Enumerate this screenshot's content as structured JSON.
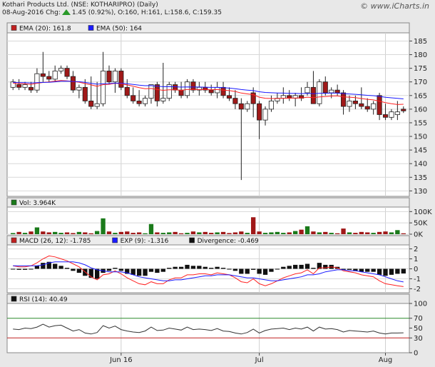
{
  "header": {
    "line1": "Kothari Products Ltd. (NSE: KOTHARIPRO) (Daily)",
    "date_chg": "08-Aug-2016 Chg:",
    "change": "1.45 (0.92%), O:160, H:161, L:158.6, C:159.35"
  },
  "brand": "© www.iCharts.in",
  "colors": {
    "up": "#ffffff",
    "down": "#a01818",
    "ema20": "#ff2020",
    "ema50": "#1a1aff",
    "vol_up": "#1a7a1a",
    "vol_down": "#a01818",
    "macd": "#ff2020",
    "signal": "#1a1aff",
    "rsi": "#333333",
    "rsi_upper": "#2a8a2a",
    "rsi_lower": "#c02020"
  },
  "chart_data": [
    {
      "type": "candlestick",
      "legend": [
        {
          "label": "EMA (20): 161.8",
          "color": "#c02020"
        },
        {
          "label": "EMA (50): 164",
          "color": "#1a1aff"
        }
      ],
      "ylim": [
        128,
        188
      ],
      "yticks": [
        130,
        135,
        140,
        145,
        150,
        155,
        160,
        165,
        170,
        175,
        180,
        185
      ],
      "xticks": [
        {
          "label": "Jun 16",
          "index": 18
        },
        {
          "label": "Jul",
          "index": 41
        },
        {
          "label": "Aug",
          "index": 62
        }
      ],
      "ohlc": [
        [
          168,
          171,
          167,
          170
        ],
        [
          169,
          171,
          167,
          168
        ],
        [
          168,
          170,
          167,
          169
        ],
        [
          168,
          170,
          166,
          167
        ],
        [
          167,
          175,
          166,
          173
        ],
        [
          173,
          181,
          170,
          172
        ],
        [
          172,
          174,
          170,
          171
        ],
        [
          171,
          176,
          170,
          174
        ],
        [
          174,
          176,
          173,
          175
        ],
        [
          175,
          176,
          171,
          172
        ],
        [
          172,
          174,
          166,
          167
        ],
        [
          167,
          169,
          164,
          168
        ],
        [
          168,
          171,
          162,
          163
        ],
        [
          163,
          172,
          160,
          161
        ],
        [
          161,
          170,
          160,
          162
        ],
        [
          162,
          181,
          161,
          174
        ],
        [
          174,
          176,
          169,
          170
        ],
        [
          170,
          175,
          166,
          174
        ],
        [
          174,
          175,
          167,
          168
        ],
        [
          168,
          171,
          164,
          165
        ],
        [
          165,
          168,
          162,
          163
        ],
        [
          163,
          167,
          161,
          162
        ],
        [
          162,
          165,
          161,
          164
        ],
        [
          164,
          169,
          162,
          169
        ],
        [
          169,
          170,
          161,
          163
        ],
        [
          163,
          177,
          162,
          164
        ],
        [
          164,
          170,
          163,
          169
        ],
        [
          169,
          170,
          166,
          167
        ],
        [
          167,
          170,
          164,
          165
        ],
        [
          165,
          171,
          164,
          170
        ],
        [
          170,
          171,
          166,
          167
        ],
        [
          167,
          170,
          165,
          168
        ],
        [
          168,
          170,
          166,
          167
        ],
        [
          167,
          169,
          165,
          166
        ],
        [
          166,
          170,
          164,
          168
        ],
        [
          168,
          170,
          164,
          165
        ],
        [
          165,
          168,
          163,
          164
        ],
        [
          164,
          167,
          160,
          162
        ],
        [
          162,
          164,
          134,
          160
        ],
        [
          160,
          163,
          159,
          162
        ],
        [
          166,
          168,
          157,
          162
        ],
        [
          162,
          163,
          149,
          156
        ],
        [
          156,
          161,
          154,
          160
        ],
        [
          160,
          165,
          159,
          163
        ],
        [
          163,
          166,
          162,
          164
        ],
        [
          164,
          168,
          162,
          165
        ],
        [
          165,
          167,
          163,
          164
        ],
        [
          164,
          166,
          161,
          165
        ],
        [
          165,
          168,
          163,
          164
        ],
        [
          166,
          170,
          165,
          168
        ],
        [
          168,
          174,
          162,
          162
        ],
        [
          162,
          171,
          161,
          170
        ],
        [
          170,
          172,
          165,
          166
        ],
        [
          166,
          168,
          164,
          167
        ],
        [
          167,
          169,
          165,
          166
        ],
        [
          166,
          167,
          158,
          161
        ],
        [
          161,
          165,
          159,
          163
        ],
        [
          163,
          165,
          160,
          162
        ],
        [
          162,
          168,
          160,
          161
        ],
        [
          161,
          164,
          159,
          160
        ],
        [
          160,
          163,
          158,
          162
        ],
        [
          165,
          166,
          156,
          158
        ],
        [
          158,
          162,
          156,
          157
        ],
        [
          157,
          160,
          156,
          159
        ],
        [
          158,
          163,
          156,
          159
        ],
        [
          160,
          161,
          158.6,
          159.35
        ]
      ],
      "ema20": [
        169.5,
        169.4,
        169.3,
        169.1,
        169.5,
        169.8,
        170,
        170.3,
        170.5,
        170.4,
        170.1,
        169.9,
        169.4,
        168.9,
        168.4,
        169,
        169.1,
        169.5,
        169.3,
        168.9,
        168.4,
        167.9,
        167.5,
        167.6,
        167.2,
        166.9,
        167.1,
        167.1,
        166.9,
        167.2,
        167.2,
        167.2,
        167.2,
        167.1,
        167.2,
        167,
        166.8,
        166.5,
        165.9,
        165.6,
        165.3,
        164.4,
        164,
        163.9,
        163.9,
        164,
        164,
        164.1,
        164.1,
        164.4,
        164.2,
        164.5,
        164.6,
        164.8,
        164.9,
        164.5,
        164.4,
        164.2,
        163.9,
        163.6,
        163.4,
        162.9,
        162.4,
        162,
        161.7,
        161.8
      ]
    },
    {
      "type": "bar",
      "legend": [
        {
          "label": "Vol: 3.964K",
          "color": "#1a7a1a"
        }
      ],
      "ylim": [
        0,
        120000
      ],
      "yticks": [
        {
          "label": "100K",
          "value": 100000
        },
        {
          "label": "50K",
          "value": 50000
        },
        {
          "label": "0K",
          "value": 0
        }
      ],
      "values": [
        5000,
        10000,
        6000,
        12000,
        30000,
        12000,
        8000,
        10000,
        6000,
        8000,
        5000,
        10000,
        8000,
        4000,
        14000,
        70000,
        12000,
        6000,
        10000,
        12000,
        6000,
        8000,
        4000,
        45000,
        8000,
        6000,
        8000,
        10000,
        4000,
        6000,
        12000,
        8000,
        10000,
        6000,
        8000,
        10000,
        5000,
        8000,
        12000,
        6000,
        75000,
        12000,
        6000,
        8000,
        10000,
        6000,
        8000,
        14000,
        20000,
        35000,
        12000,
        8000,
        10000,
        6000,
        4000,
        25000,
        8000,
        6000,
        10000,
        8000,
        6000,
        10000,
        12000,
        8000,
        18000,
        3964
      ]
    },
    {
      "type": "line",
      "legend": [
        {
          "label": "MACD (26, 12): -1.785",
          "color": "#c02020"
        },
        {
          "label": "EXP (9): -1.316",
          "color": "#1a1aff"
        },
        {
          "label": "Divergence: -0.469",
          "color": "#111111"
        }
      ],
      "ylim": [
        -2.4,
        2.4
      ],
      "yticks": [
        2,
        1,
        0,
        -1,
        -2
      ],
      "macd": [
        0.3,
        0.2,
        0.2,
        0.3,
        0.6,
        1.0,
        1.3,
        1.2,
        1.0,
        0.8,
        0.5,
        0.2,
        -0.3,
        -0.8,
        -1.1,
        -0.6,
        -0.5,
        -0.2,
        -0.5,
        -0.9,
        -1.2,
        -1.5,
        -1.6,
        -1.3,
        -1.5,
        -1.5,
        -1.1,
        -0.9,
        -0.9,
        -0.6,
        -0.6,
        -0.5,
        -0.5,
        -0.6,
        -0.4,
        -0.5,
        -0.6,
        -0.9,
        -1.3,
        -1.4,
        -1.0,
        -1.5,
        -1.7,
        -1.5,
        -1.2,
        -0.9,
        -0.7,
        -0.5,
        -0.4,
        -0.1,
        -0.5,
        0.1,
        0.1,
        0.2,
        0.1,
        -0.2,
        -0.3,
        -0.4,
        -0.6,
        -0.7,
        -0.8,
        -1.2,
        -1.5,
        -1.6,
        -1.7,
        -1.785
      ],
      "signal": [
        0.3,
        0.3,
        0.3,
        0.3,
        0.3,
        0.4,
        0.6,
        0.7,
        0.7,
        0.7,
        0.7,
        0.6,
        0.4,
        0.1,
        -0.1,
        -0.2,
        -0.3,
        -0.3,
        -0.3,
        -0.4,
        -0.6,
        -0.8,
        -0.9,
        -1.0,
        -1.1,
        -1.2,
        -1.2,
        -1.1,
        -1.1,
        -1.0,
        -0.9,
        -0.8,
        -0.7,
        -0.7,
        -0.6,
        -0.6,
        -0.6,
        -0.7,
        -0.8,
        -0.9,
        -0.9,
        -1.0,
        -1.1,
        -1.2,
        -1.2,
        -1.1,
        -1.0,
        -0.9,
        -0.8,
        -0.6,
        -0.6,
        -0.5,
        -0.3,
        -0.2,
        -0.1,
        -0.1,
        -0.2,
        -0.2,
        -0.3,
        -0.4,
        -0.5,
        -0.6,
        -0.8,
        -1.0,
        -1.2,
        -1.316
      ],
      "divergence": [
        0,
        -0.1,
        -0.1,
        0,
        0.3,
        0.6,
        0.7,
        0.5,
        0.3,
        0.1,
        -0.2,
        -0.4,
        -0.7,
        -0.9,
        -1.0,
        -0.4,
        -0.2,
        0.1,
        -0.2,
        -0.5,
        -0.6,
        -0.7,
        -0.7,
        -0.3,
        -0.4,
        -0.3,
        0.1,
        0.2,
        0.2,
        0.4,
        0.3,
        0.3,
        0.2,
        0.1,
        0.2,
        0.1,
        0,
        -0.2,
        -0.5,
        -0.5,
        -0.1,
        -0.5,
        -0.6,
        -0.3,
        0,
        0.2,
        0.3,
        0.4,
        0.4,
        0.5,
        0.1,
        0.6,
        0.4,
        0.4,
        0.2,
        -0.1,
        -0.1,
        -0.2,
        -0.3,
        -0.3,
        -0.3,
        -0.6,
        -0.7,
        -0.6,
        -0.5,
        -0.469
      ]
    },
    {
      "type": "line",
      "legend": [
        {
          "label": "RSI (14): 40.49",
          "color": "#111111"
        }
      ],
      "ylim": [
        0,
        100
      ],
      "yticks": [
        100,
        70,
        50,
        30,
        0
      ],
      "upper": 70,
      "lower": 30,
      "values": [
        48,
        47,
        50,
        49,
        52,
        58,
        52,
        55,
        56,
        50,
        44,
        47,
        40,
        38,
        41,
        55,
        50,
        54,
        47,
        44,
        42,
        41,
        44,
        52,
        45,
        46,
        50,
        48,
        46,
        52,
        47,
        48,
        47,
        45,
        49,
        44,
        43,
        40,
        38,
        41,
        48,
        40,
        45,
        48,
        49,
        50,
        47,
        50,
        48,
        52,
        44,
        52,
        48,
        49,
        47,
        42,
        45,
        44,
        43,
        42,
        44,
        40,
        38,
        40,
        40,
        40.49
      ]
    }
  ]
}
